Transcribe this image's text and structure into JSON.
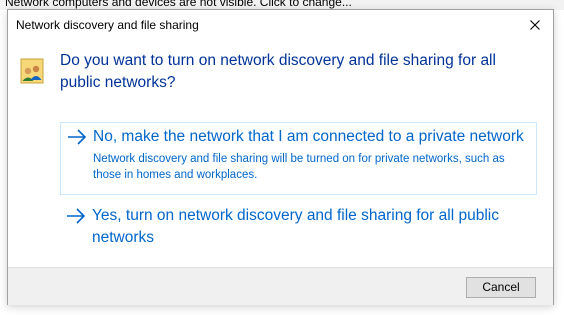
{
  "background_infobar": {
    "text": "Network computers and devices are not visible. Click to change..."
  },
  "dialog": {
    "title": "Network discovery and file sharing",
    "question": "Do you want to turn on network discovery and file sharing for all public networks?",
    "options": [
      {
        "title": "No, make the network that I am connected to a private network",
        "description": "Network discovery and file sharing will be turned on for private networks, such as those in homes and workplaces."
      },
      {
        "title": "Yes, turn on network discovery and file sharing for all public networks",
        "description": ""
      }
    ],
    "cancel_label": "Cancel",
    "icons": {
      "header": "network-users-icon",
      "close": "close-icon",
      "option_arrow": "arrow-right-icon"
    }
  },
  "colors": {
    "question_text": "#003399",
    "link_text": "#0066cc",
    "option_highlight_border": "#cce8ff",
    "footer_background": "#f0f0f0"
  }
}
